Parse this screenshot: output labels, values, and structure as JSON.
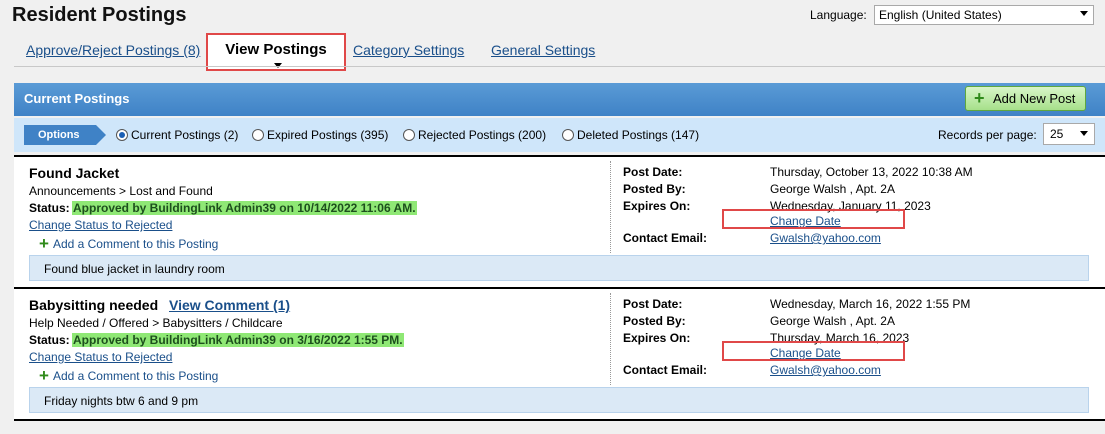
{
  "page": {
    "title": "Resident Postings"
  },
  "language": {
    "label": "Language:",
    "value": "English (United States)"
  },
  "tabs": [
    {
      "label": "Approve/Reject Postings (8)"
    },
    {
      "label": "View Postings"
    },
    {
      "label": "Category Settings"
    },
    {
      "label": "General Settings"
    }
  ],
  "section": {
    "title": "Current Postings",
    "add_button": "Add New Post"
  },
  "options": {
    "label": "Options",
    "filters": [
      {
        "label": "Current Postings (2)",
        "selected": true
      },
      {
        "label": "Expired Postings (395)",
        "selected": false
      },
      {
        "label": "Rejected Postings (200)",
        "selected": false
      },
      {
        "label": "Deleted Postings (147)",
        "selected": false
      }
    ],
    "records_label": "Records per page:",
    "records_value": "25"
  },
  "meta_labels": {
    "post_date": "Post Date:",
    "posted_by": "Posted By:",
    "expires_on": "Expires On:",
    "contact_email": "Contact Email:"
  },
  "posts": [
    {
      "title": "Found Jacket",
      "view_comment": "",
      "category": "Announcements > Lost and Found",
      "status_label": "Status:",
      "status": "Approved by BuildingLink Admin39 on 10/14/2022 11:06 AM.",
      "change_status": "Change Status to Rejected",
      "add_comment": "Add a Comment to this Posting",
      "post_date": "Thursday, October 13, 2022 10:38 AM",
      "posted_by": "George Walsh , Apt. 2A",
      "expires_on": "Wednesday, January 11, 2023",
      "change_date": "Change Date",
      "contact_email": "Gwalsh@yahoo.com",
      "description": "Found blue jacket in laundry room"
    },
    {
      "title": "Babysitting needed",
      "view_comment": "View  Comment (1)",
      "category": "Help Needed / Offered > Babysitters / Childcare",
      "status_label": "Status:",
      "status": "Approved by BuildingLink Admin39 on 3/16/2022 1:55 PM.",
      "change_status": "Change Status to Rejected",
      "add_comment": "Add a Comment to this Posting",
      "post_date": "Wednesday, March 16, 2022 1:55 PM",
      "posted_by": "George Walsh , Apt. 2A",
      "expires_on": "Thursday, March 16, 2023",
      "change_date": "Change Date",
      "contact_email": "Gwalsh@yahoo.com",
      "description": "Friday nights btw 6 and 9 pm"
    }
  ]
}
